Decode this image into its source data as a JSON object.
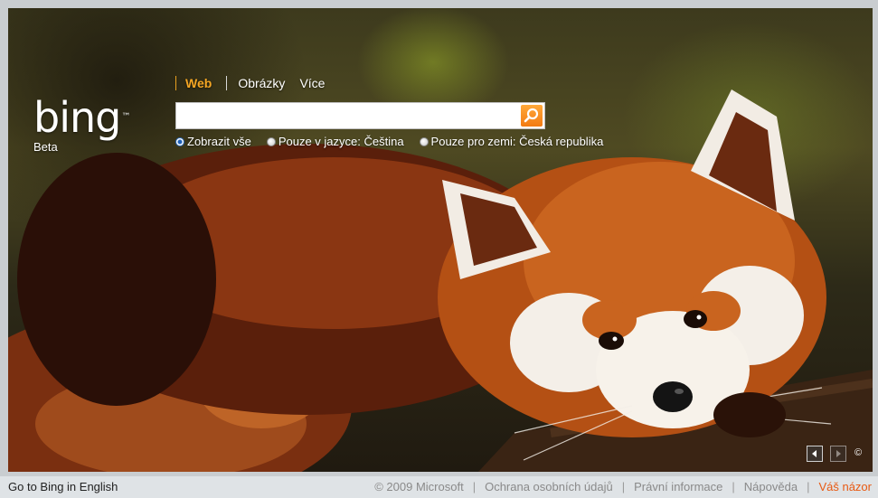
{
  "logo": {
    "word": "bing",
    "tm": "™",
    "beta": "Beta"
  },
  "nav": {
    "items": [
      "Web",
      "Obrázky",
      "Více"
    ]
  },
  "search": {
    "value": "",
    "placeholder": ""
  },
  "scope": {
    "options": [
      "Zobrazit vše",
      "Pouze v jazyce: Čeština",
      "Pouze pro zemi: Česká republika"
    ],
    "selected": 0
  },
  "hero": {
    "copyright_glyph": "©",
    "prev_glyph": "◄",
    "next_glyph": "►"
  },
  "footer": {
    "english_link": "Go to Bing in English",
    "copyright": "© 2009 Microsoft",
    "links": [
      "Ochrana osobních údajů",
      "Právní informace",
      "Nápověda"
    ],
    "feedback": "Váš názor",
    "separator": "|"
  },
  "colors": {
    "accent": "#f5a623",
    "feedback": "#e85a13"
  }
}
